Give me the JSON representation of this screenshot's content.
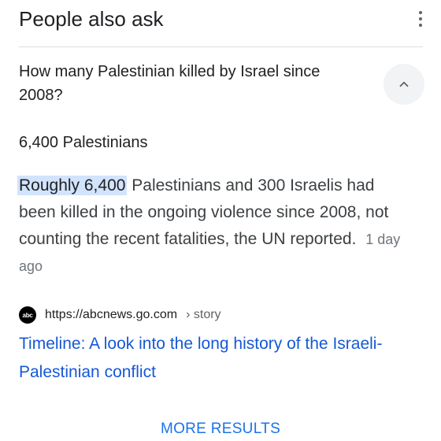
{
  "header": {
    "title": "People also ask"
  },
  "question": {
    "text": "How many Palestinian killed by Israel since 2008?",
    "expanded": true
  },
  "answer": {
    "short": "6,400 Palestinians",
    "highlight": "Roughly 6,400",
    "rest": " Palestinians and 300 Israelis had been killed in the ongoing violence since 2008, not counting the recent fatalities, the UN reported.",
    "date": "1 day ago"
  },
  "source": {
    "logo_text": "abc",
    "url": "https://abcnews.go.com",
    "breadcrumb": "› story",
    "title": "Timeline: A look into the long history of the Israeli-Palestinian conflict"
  },
  "footer": {
    "more_label": "MORE RESULTS"
  },
  "colors": {
    "link": "#1558d6",
    "accent": "#1a73e8",
    "highlight": "#d2e3fc"
  }
}
